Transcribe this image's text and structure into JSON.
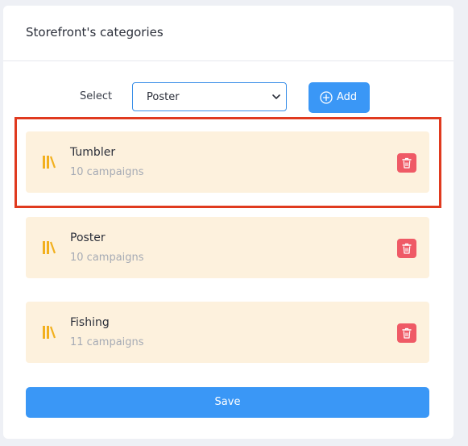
{
  "header": {
    "title": "Storefront's categories"
  },
  "select_row": {
    "label": "Select",
    "selected_value": "Poster",
    "add_label": "Add"
  },
  "categories": [
    {
      "name": "Tumbler",
      "count": "10 campaigns"
    },
    {
      "name": "Poster",
      "count": "10 campaigns"
    },
    {
      "name": "Fishing",
      "count": "11 campaigns"
    }
  ],
  "footer": {
    "save_label": "Save"
  },
  "colors": {
    "accent": "#3a97f6",
    "category_bg": "#fdf1dd",
    "delete": "#ef5a66",
    "icon": "#f2b01e",
    "highlight": "#e03a1f"
  },
  "icons": {
    "category": "books-icon",
    "add": "plus-circle-icon",
    "delete": "trash-icon",
    "dropdown": "chevron-down-icon"
  }
}
